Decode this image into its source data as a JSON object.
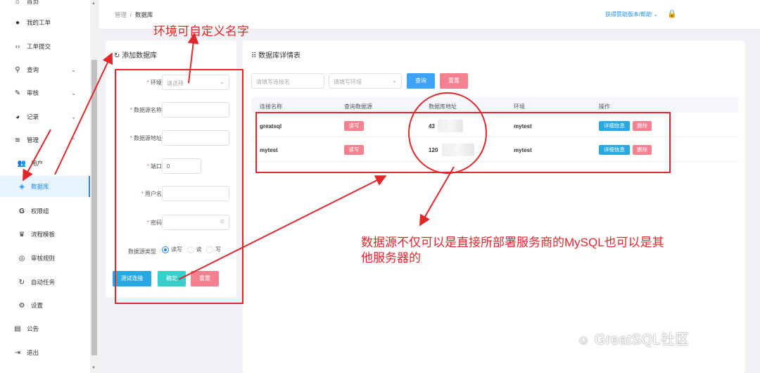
{
  "sidebar": {
    "items": [
      {
        "label": "首页",
        "icon": "home-icon"
      },
      {
        "label": "我的工单",
        "icon": "user-icon"
      },
      {
        "label": "工单提交",
        "icon": "code-icon"
      },
      {
        "label": "查询",
        "icon": "search-icon"
      },
      {
        "label": "审核",
        "icon": "edit-icon"
      },
      {
        "label": "记录",
        "icon": "pie-chart-icon"
      },
      {
        "label": "管理",
        "icon": "layers-icon"
      },
      {
        "label": "用户",
        "icon": "users-icon"
      },
      {
        "label": "数据库",
        "icon": "database-icon"
      },
      {
        "label": "权限组",
        "icon": "g-icon"
      },
      {
        "label": "流程模板",
        "icon": "trophy-icon"
      },
      {
        "label": "审核规则",
        "icon": "target-icon"
      },
      {
        "label": "自动任务",
        "icon": "sync-icon"
      },
      {
        "label": "设置",
        "icon": "gear-icon"
      },
      {
        "label": "公告",
        "icon": "clipboard-icon"
      },
      {
        "label": "退出",
        "icon": "logout-icon"
      }
    ]
  },
  "header": {
    "breadcrumb_root": "管理",
    "breadcrumb_sep": "/",
    "breadcrumb_current": "数据库",
    "help": "获得赞助版本/帮助",
    "help_chevron": "⌄",
    "lock_glyph": "🔒"
  },
  "add_form": {
    "title": "添加数据库",
    "env_label": "环境",
    "env_placeholder": "请选择",
    "name_label": "数据源名称",
    "addr_label": "数据源地址",
    "port_label": "端口",
    "port_value": "0",
    "user_label": "用户名",
    "pwd_label": "密码",
    "type_label": "数据源类型",
    "type_options": [
      "读写",
      "读",
      "写"
    ],
    "type_selected": "读写",
    "test_button": "测试连接",
    "ok_button": "确定",
    "reset_button": "重置"
  },
  "detail": {
    "title": "数据库详情表",
    "search_placeholder": "请填写连接名",
    "env_placeholder": "请填写环境",
    "query_button": "查询",
    "reset_button": "重置",
    "columns": [
      "连接名称",
      "查询数据源",
      "数据库地址",
      "环境",
      "操作"
    ],
    "rows": [
      {
        "name": "greatsql",
        "source": "读写",
        "addr": "43",
        "env": "mytest",
        "detail_btn": "详细信息",
        "delete_btn": "删除"
      },
      {
        "name": "mytest",
        "source": "读写",
        "addr": "120",
        "env": "mytest",
        "detail_btn": "详细信息",
        "delete_btn": "删除"
      }
    ]
  },
  "annotations": {
    "env_note": "环境可自定义名字",
    "source_note_line1": "数据源不仅可以是直接所部署服务商的MySQL也可以是其",
    "source_note_line2": "他服务器的"
  },
  "watermark": "GreatSQL社区",
  "colors": {
    "primary": "#1890ff",
    "danger": "#f56c6c",
    "pink": "#f3818f",
    "teal": "#36cfc9",
    "info": "#27a9e3",
    "annotation": "#e0282b"
  }
}
